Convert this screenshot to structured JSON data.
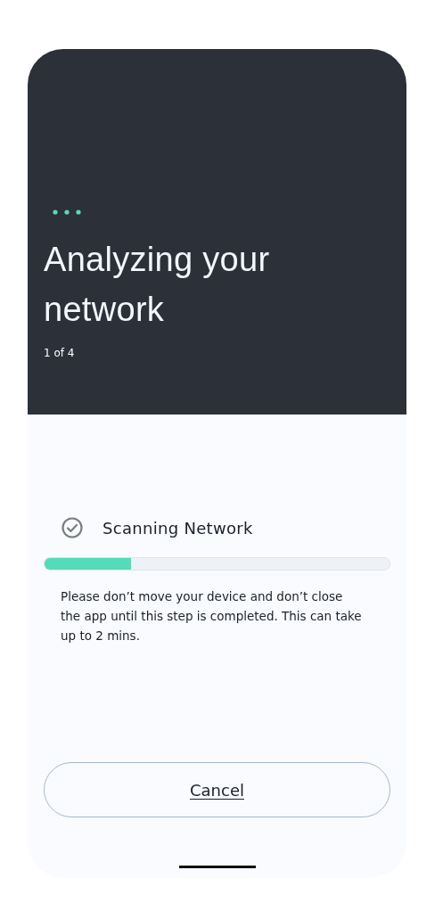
{
  "header": {
    "title": "Analyzing your network",
    "step": "1 of 4"
  },
  "task": {
    "label": "Scanning Network",
    "level": 0.25,
    "message": "Please don’t move your device and don’t close the app until this step is completed. This can take up to 2 mins."
  },
  "buttons": [
    {
      "label": "Cancel"
    }
  ]
}
